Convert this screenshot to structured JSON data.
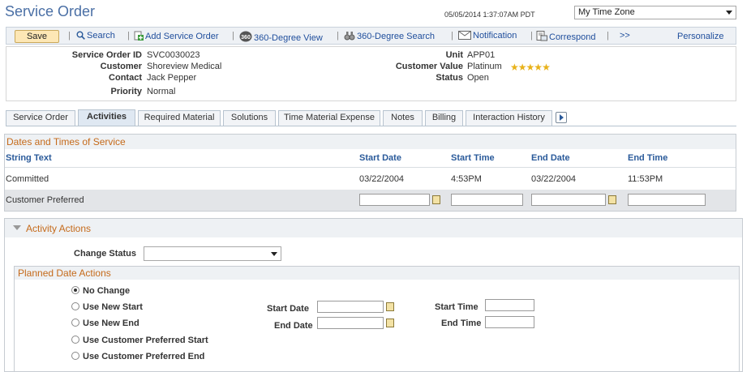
{
  "page": {
    "title": "Service Order",
    "datetime": "05/05/2014 1:37:07AM PDT",
    "timezone": "My Time Zone"
  },
  "toolbar": {
    "save": "Save",
    "search": "Search",
    "add_service_order": "Add Service Order",
    "view_360": "360-Degree View",
    "search_360": "360-Degree Search",
    "notification": "Notification",
    "correspond": "Correspond",
    "more": ">>",
    "personalize": "Personalize",
    "icons": [
      "search-icon",
      "add-icon",
      "360-icon",
      "binoculars-icon",
      "envelope-icon",
      "correspond-icon"
    ]
  },
  "info": {
    "service_order_id_label": "Service Order ID",
    "service_order_id": "SVC0030023",
    "customer_label": "Customer",
    "customer": "Shoreview Medical",
    "contact_label": "Contact",
    "contact": "Jack Pepper",
    "priority_label": "Priority",
    "priority": "Normal",
    "unit_label": "Unit",
    "unit": "APP01",
    "customer_value_label": "Customer Value",
    "customer_value": "Platinum",
    "stars": 5,
    "status_label": "Status",
    "status": "Open"
  },
  "tabs": [
    "Service Order",
    "Activities",
    "Required Material",
    "Solutions",
    "Time Material Expense",
    "Notes",
    "Billing",
    "Interaction History"
  ],
  "active_tab": "Activities",
  "dates": {
    "title": "Dates and Times of Service",
    "headers": [
      "String Text",
      "Start Date",
      "Start Time",
      "End Date",
      "End Time"
    ],
    "rows": [
      {
        "string_text": "Committed",
        "start_date": "03/22/2004",
        "start_time": "4:53PM",
        "end_date": "03/22/2004",
        "end_time": "11:53PM"
      },
      {
        "string_text": "Customer Preferred",
        "start_date": "",
        "start_time": "",
        "end_date": "",
        "end_time": ""
      }
    ]
  },
  "activity": {
    "title": "Activity Actions",
    "change_status_label": "Change Status",
    "change_status_value": "",
    "planned_title": "Planned Date Actions",
    "options": [
      "No Change",
      "Use New Start",
      "Use New End",
      "Use Customer Preferred Start",
      "Use Customer Preferred End"
    ],
    "selected_option": "No Change",
    "start_date_label": "Start Date",
    "end_date_label": "End Date",
    "start_time_label": "Start Time",
    "end_time_label": "End Time"
  },
  "colors": {
    "accent_orange": "#c56a1a",
    "link_blue": "#1f4e9c",
    "star_gold": "#e8b21a"
  }
}
